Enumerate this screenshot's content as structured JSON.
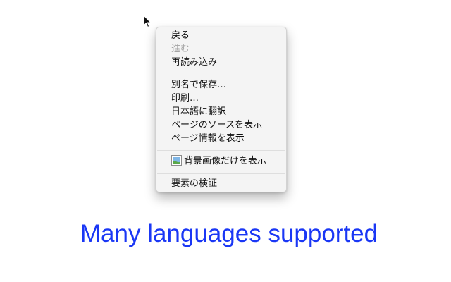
{
  "context_menu": {
    "items": [
      {
        "label": "戻る",
        "enabled": true
      },
      {
        "label": "進む",
        "enabled": false
      },
      {
        "label": "再読み込み",
        "enabled": true
      },
      {
        "label": "別名で保存…",
        "enabled": true
      },
      {
        "label": "印刷…",
        "enabled": true
      },
      {
        "label": "日本語に翻訳",
        "enabled": true
      },
      {
        "label": "ページのソースを表示",
        "enabled": true
      },
      {
        "label": "ページ情報を表示",
        "enabled": true
      },
      {
        "label": "背景画像だけを表示",
        "enabled": true,
        "icon": "image-icon"
      },
      {
        "label": "要素の検証",
        "enabled": true
      }
    ]
  },
  "caption": "Many languages supported",
  "colors": {
    "caption": "#1a37f5",
    "disabled_text": "#a3a3a3",
    "menu_background": "#f4f4f4"
  }
}
